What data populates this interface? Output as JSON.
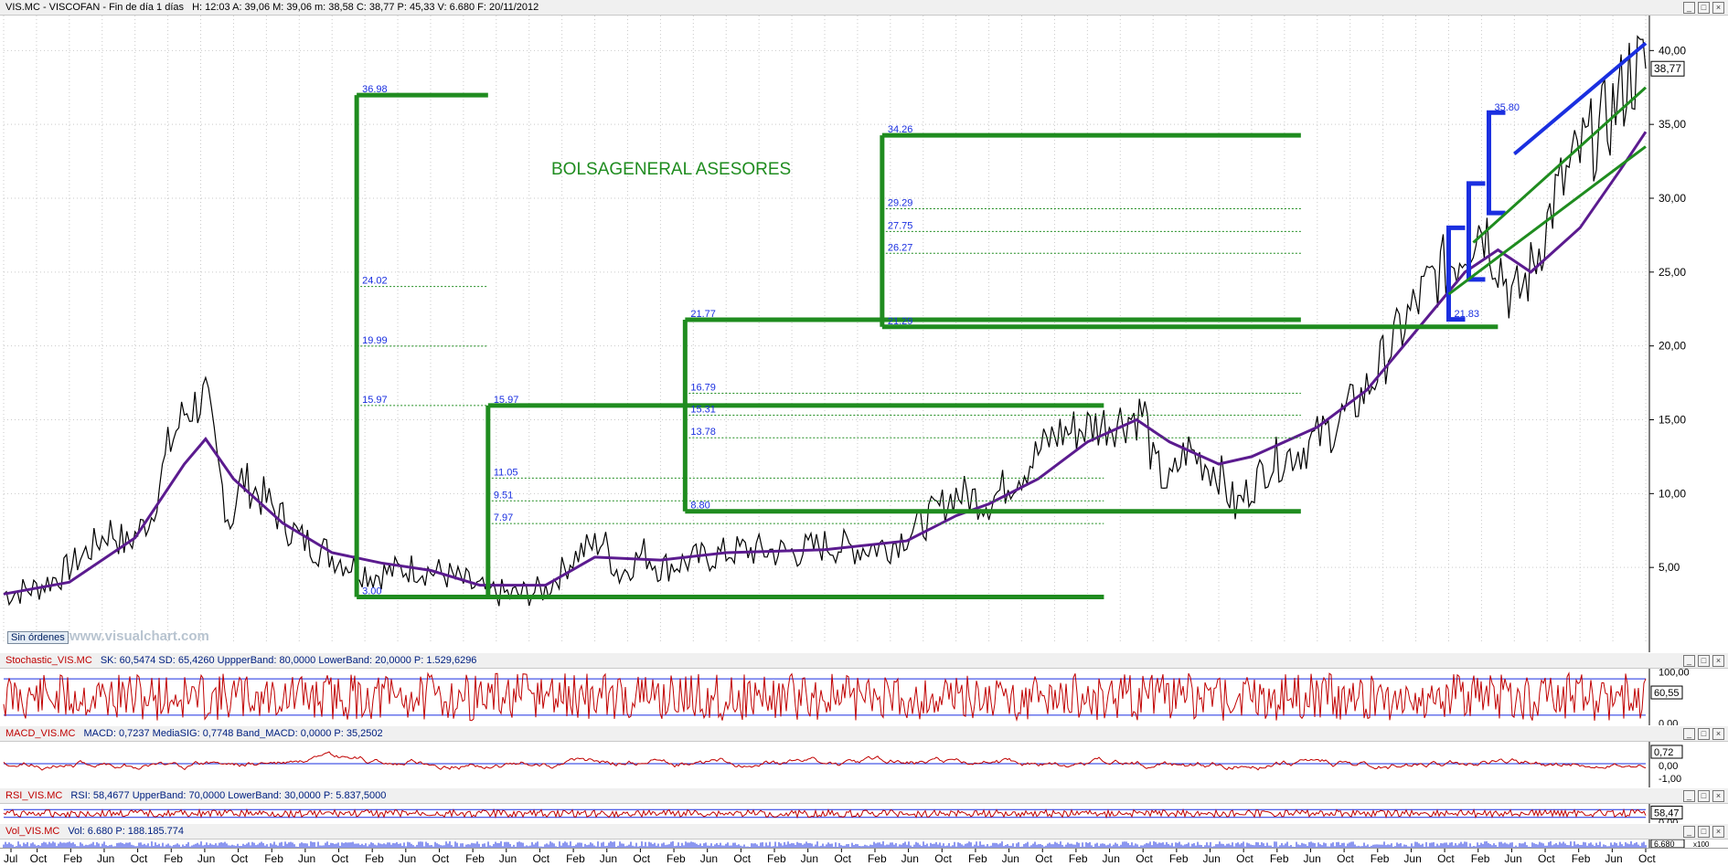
{
  "main_header": {
    "symbol": "VIS.MC - VISCOFAN - Fin de día 1 días",
    "stats": "H: 12:03  A: 39,06  M: 39,06  m: 38,58  C: 38,77  P: 45,33  V: 6.680  F: 20/11/2012"
  },
  "annotation_title": "BOLSAGENERAL ASESORES",
  "sin_ordenes": "Sin órdenes",
  "watermark": "www.visualchart.com",
  "last_price": "38,77",
  "colors": {
    "price": "#000000",
    "ma": "#5b1b8f",
    "channel": "#1f8c1f",
    "fib_blue": "#1a2fe0",
    "stoch": "#c00000",
    "band": "#1a2fe0"
  },
  "stoch_header": {
    "name": "Stochastic_VIS.MC",
    "values": "SK: 60,5474  SD: 65,4260  UppperBand: 80,0000  LowerBand: 20,0000  P: 1.529,6296",
    "last": "60,55"
  },
  "macd_header": {
    "name": "MACD_VIS.MC",
    "values": "MACD: 0,7237  MediaSIG: 0,7748  Band_MACD: 0,0000  P: 35,2502",
    "last": "0,72"
  },
  "rsi_header": {
    "name": "RSI_VIS.MC",
    "values": "RSI: 58,4677  UpperBand: 70,0000  LowerBand: 30,0000  P: 5.837,5000",
    "last": "58,47"
  },
  "vol_header": {
    "name": "Vol_VIS.MC",
    "values": "Vol: 6.680  P: 188.185.774",
    "last": "6.680"
  },
  "right_axis": {
    "price_ticks": [
      "40,00",
      "35,00",
      "30,00",
      "25,00",
      "20,00",
      "15,00",
      "10,00",
      "5,00"
    ],
    "stoch_ticks": [
      "100,00",
      "0,00"
    ],
    "macd_ticks": [
      "0,00",
      "-1,00"
    ],
    "rsi_ticks": [
      "0,00"
    ],
    "vol_badge": "x100"
  },
  "x_labels": [
    "Jul",
    "Oct",
    "Feb",
    "Jun",
    "Oct",
    "Feb",
    "Jun",
    "Oct",
    "Feb",
    "Jun",
    "Oct",
    "Feb",
    "Jun",
    "Oct",
    "Feb",
    "Jun",
    "Oct",
    "Feb",
    "Jun",
    "Oct",
    "Feb",
    "Jun",
    "Oct",
    "Feb",
    "Jun",
    "Oct",
    "Feb",
    "Jun",
    "Oct",
    "Feb",
    "Jun",
    "Oct",
    "Feb",
    "Jun",
    "Oct",
    "Feb",
    "Jun",
    "Oct",
    "Feb",
    "Jun",
    "Oct",
    "Feb",
    "Jun",
    "Oct",
    "Feb",
    "Jun",
    "Oct",
    "Feb",
    "Jun",
    "Oct"
  ],
  "chart_data": {
    "type": "line",
    "ylim": [
      0,
      42
    ],
    "price_path": [
      [
        0,
        3.2
      ],
      [
        0.02,
        3.6
      ],
      [
        0.035,
        4.5
      ],
      [
        0.05,
        6
      ],
      [
        0.065,
        7.5
      ],
      [
        0.075,
        6.5
      ],
      [
        0.09,
        8.5
      ],
      [
        0.1,
        13
      ],
      [
        0.11,
        15.5
      ],
      [
        0.123,
        16.5
      ],
      [
        0.13,
        12
      ],
      [
        0.138,
        8
      ],
      [
        0.145,
        11
      ],
      [
        0.16,
        9.5
      ],
      [
        0.18,
        7
      ],
      [
        0.2,
        5.8
      ],
      [
        0.225,
        4.5
      ],
      [
        0.25,
        5
      ],
      [
        0.27,
        4.5
      ],
      [
        0.29,
        3.5
      ],
      [
        0.31,
        3.1
      ],
      [
        0.33,
        3.5
      ],
      [
        0.35,
        6
      ],
      [
        0.365,
        6.8
      ],
      [
        0.375,
        4.5
      ],
      [
        0.39,
        6
      ],
      [
        0.4,
        5
      ],
      [
        0.42,
        5.5
      ],
      [
        0.45,
        6.2
      ],
      [
        0.48,
        6
      ],
      [
        0.5,
        6.5
      ],
      [
        0.52,
        6.3
      ],
      [
        0.54,
        6.5
      ],
      [
        0.56,
        8
      ],
      [
        0.58,
        10
      ],
      [
        0.6,
        9.5
      ],
      [
        0.62,
        11.5
      ],
      [
        0.64,
        14
      ],
      [
        0.66,
        14.5
      ],
      [
        0.68,
        15
      ],
      [
        0.695,
        15.5
      ],
      [
        0.7,
        12
      ],
      [
        0.71,
        10.5
      ],
      [
        0.72,
        13
      ],
      [
        0.74,
        11.5
      ],
      [
        0.75,
        9
      ],
      [
        0.77,
        12
      ],
      [
        0.79,
        13
      ],
      [
        0.81,
        14.5
      ],
      [
        0.83,
        17
      ],
      [
        0.85,
        21
      ],
      [
        0.87,
        24.5
      ],
      [
        0.885,
        26
      ],
      [
        0.9,
        28.5
      ],
      [
        0.91,
        26
      ],
      [
        0.92,
        23
      ],
      [
        0.93,
        25
      ],
      [
        0.945,
        30
      ],
      [
        0.96,
        33
      ],
      [
        0.975,
        35
      ],
      [
        0.985,
        37
      ],
      [
        0.99,
        38.5
      ],
      [
        1,
        38.77
      ]
    ],
    "ma_path": [
      [
        0,
        3.2
      ],
      [
        0.04,
        4
      ],
      [
        0.08,
        7
      ],
      [
        0.11,
        12
      ],
      [
        0.123,
        13.7
      ],
      [
        0.14,
        11
      ],
      [
        0.17,
        8
      ],
      [
        0.2,
        6
      ],
      [
        0.23,
        5.3
      ],
      [
        0.26,
        4.8
      ],
      [
        0.29,
        3.8
      ],
      [
        0.33,
        3.8
      ],
      [
        0.36,
        5.7
      ],
      [
        0.4,
        5.5
      ],
      [
        0.44,
        6
      ],
      [
        0.5,
        6.2
      ],
      [
        0.55,
        6.8
      ],
      [
        0.58,
        8.5
      ],
      [
        0.6,
        9.3
      ],
      [
        0.63,
        11
      ],
      [
        0.66,
        13.5
      ],
      [
        0.69,
        15
      ],
      [
        0.71,
        13.5
      ],
      [
        0.74,
        12
      ],
      [
        0.76,
        12.5
      ],
      [
        0.8,
        14.5
      ],
      [
        0.83,
        17
      ],
      [
        0.86,
        21
      ],
      [
        0.89,
        25
      ],
      [
        0.91,
        26.5
      ],
      [
        0.93,
        25
      ],
      [
        0.96,
        28
      ],
      [
        0.985,
        32
      ],
      [
        1,
        34.5
      ]
    ],
    "green_channels": [
      {
        "top": 36.98,
        "bottom": 3.0,
        "levels": [
          {
            "v": 24.02,
            "l": "24.02"
          },
          {
            "v": 19.99,
            "l": "19.99"
          },
          {
            "v": 15.97,
            "l": "15.97"
          }
        ],
        "top_label": "36.98",
        "bottom_label": "3.00"
      },
      {
        "top": 15.97,
        "bottom": 3.0,
        "levels": [
          {
            "v": 11.05,
            "l": "11.05"
          },
          {
            "v": 9.51,
            "l": "9.51"
          },
          {
            "v": 7.97,
            "l": "7.97"
          }
        ],
        "top_label": "15.97",
        "bottom_label": ""
      },
      {
        "top": 21.77,
        "bottom": 8.8,
        "levels": [
          {
            "v": 16.79,
            "l": "16.79"
          },
          {
            "v": 15.31,
            "l": "15.31"
          },
          {
            "v": 13.78,
            "l": "13.78"
          }
        ],
        "top_label": "21.77",
        "bottom_label": "8.80"
      },
      {
        "top": 34.26,
        "bottom": 21.29,
        "levels": [
          {
            "v": 29.29,
            "l": "29.29"
          },
          {
            "v": 27.75,
            "l": "27.75"
          },
          {
            "v": 26.27,
            "l": "26.27"
          }
        ],
        "top_label": "34.26",
        "bottom_label": "21.29"
      }
    ],
    "blue_labels": [
      "35.80",
      "21.83"
    ]
  }
}
